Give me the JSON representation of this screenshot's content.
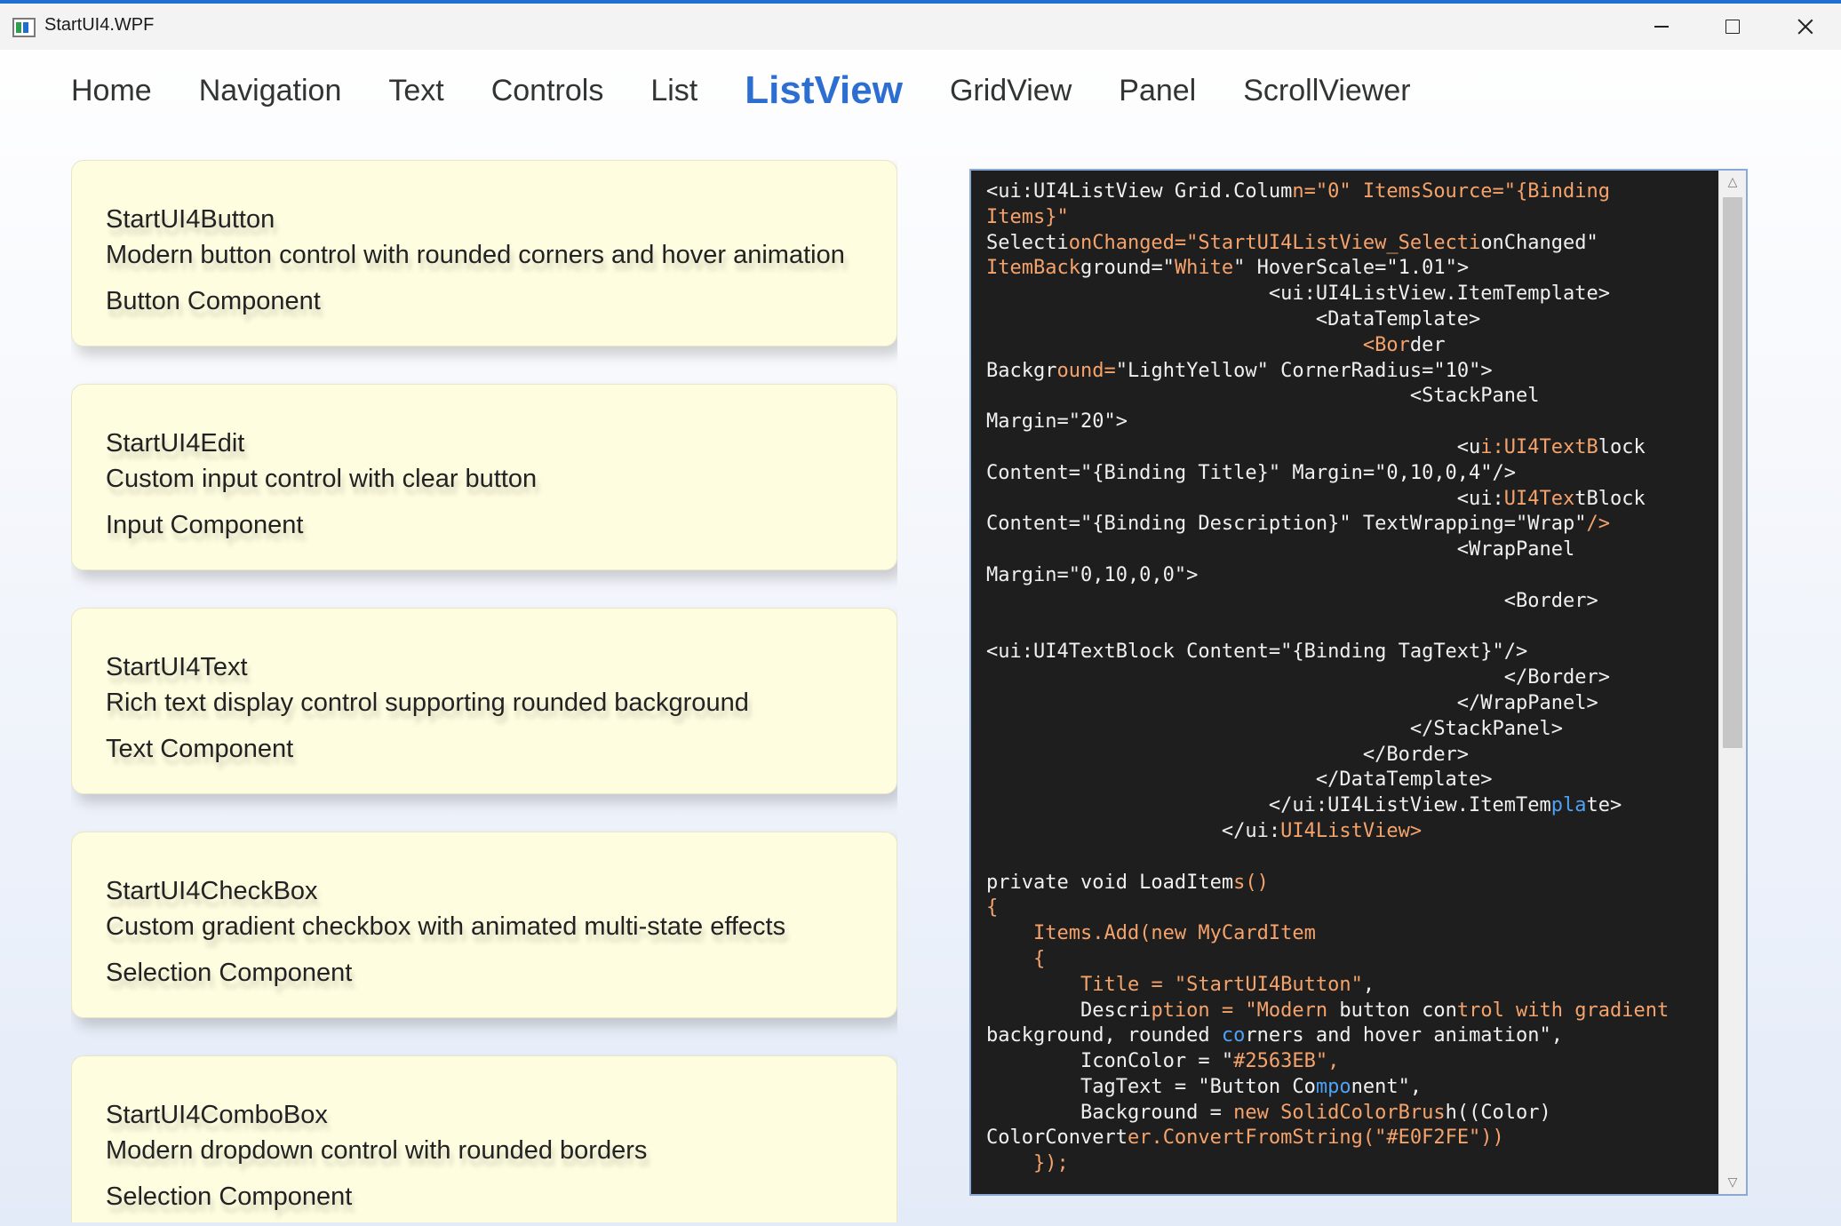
{
  "window": {
    "title": "StartUI4.WPF",
    "accent": "#1f6fd0"
  },
  "nav": {
    "items": [
      {
        "label": "Home"
      },
      {
        "label": "Navigation"
      },
      {
        "label": "Text"
      },
      {
        "label": "Controls"
      },
      {
        "label": "List"
      },
      {
        "label": "ListView",
        "active": true
      },
      {
        "label": "GridView"
      },
      {
        "label": "Panel"
      },
      {
        "label": "ScrollViewer"
      }
    ],
    "active_color": "#2d6fd1"
  },
  "cards": [
    {
      "title": "StartUI4Button",
      "description": "Modern button control with rounded corners and hover animation",
      "tag": "Button Component"
    },
    {
      "title": "StartUI4Edit",
      "description": "Custom input control with clear button",
      "tag": "Input Component"
    },
    {
      "title": "StartUI4Text",
      "description": "Rich text display control supporting rounded background",
      "tag": "Text Component"
    },
    {
      "title": "StartUI4CheckBox",
      "description": "Custom gradient checkbox with animated multi-state effects",
      "tag": "Selection Component"
    },
    {
      "title": "StartUI4ComboBox",
      "description": "Modern dropdown control with rounded borders",
      "tag": "Selection Component"
    }
  ],
  "card_background": "#fffde0",
  "code_colors": {
    "default": "#f0f0f0",
    "orange": "#f5a36b",
    "blue": "#4ea1f3"
  },
  "code": [
    [
      {
        "t": "<ui:UI4ListView Grid.Colum"
      },
      {
        "t": "n=\"0\" ItemsSource=\"{Binding",
        "c": "orange"
      }
    ],
    [
      {
        "t": "Items}\"",
        "c": "orange"
      }
    ],
    [
      {
        "t": "Selecti"
      },
      {
        "t": "onChanged=\"StartUI4ListView_Selecti",
        "c": "orange"
      },
      {
        "t": "onChanged\""
      }
    ],
    [
      {
        "t": "ItemBack",
        "c": "orange"
      },
      {
        "t": "ground=\""
      },
      {
        "t": "White",
        "c": "orange"
      },
      {
        "t": "\" HoverScale=\"1.01\">"
      }
    ],
    [
      {
        "t": "                        <ui:UI4ListView.ItemTemplate>"
      }
    ],
    [
      {
        "t": "                            <DataTemplate>"
      }
    ],
    [
      {
        "t": "                                <Bor",
        "c": "orange"
      },
      {
        "t": "der"
      }
    ],
    [
      {
        "t": "Backgr"
      },
      {
        "t": "ound=",
        "c": "orange"
      },
      {
        "t": "\"LightYellow\" CornerRadius=\"10\">"
      }
    ],
    [
      {
        "t": "                                    <StackPanel"
      }
    ],
    [
      {
        "t": "Margin=\"20\">"
      }
    ],
    [
      {
        "t": "                                        <u"
      },
      {
        "t": "i:UI4TextB",
        "c": "orange"
      },
      {
        "t": "lock"
      }
    ],
    [
      {
        "t": "Content=\"{Binding Title}\" Margin=\"0,10,0,4\"/>"
      }
    ],
    [
      {
        "t": "                                        <ui:"
      },
      {
        "t": "UI4Tex",
        "c": "orange"
      },
      {
        "t": "tBlock"
      }
    ],
    [
      {
        "t": "Content=\"{Binding Description}\" TextWrapping=\"Wrap\""
      },
      {
        "t": "/>",
        "c": "orange"
      }
    ],
    [
      {
        "t": "                                        <WrapPanel"
      }
    ],
    [
      {
        "t": "Margin=\"0,10,0,0\">"
      }
    ],
    [
      {
        "t": "                                            <Border>"
      }
    ],
    [
      {
        "t": ""
      }
    ],
    [
      {
        "t": "<ui:UI4TextBlock Content=\"{Binding TagText}\"/>"
      }
    ],
    [
      {
        "t": "                                            </Border>"
      }
    ],
    [
      {
        "t": "                                        </WrapPanel>"
      }
    ],
    [
      {
        "t": "                                    </StackPanel>"
      }
    ],
    [
      {
        "t": "                                </Border>"
      }
    ],
    [
      {
        "t": "                            </DataTemplate>"
      }
    ],
    [
      {
        "t": "                        </ui:UI4ListView.ItemTem"
      },
      {
        "t": "pla",
        "c": "blue"
      },
      {
        "t": "te>"
      }
    ],
    [
      {
        "t": "                    </ui:"
      },
      {
        "t": "UI4ListView>",
        "c": "orange"
      }
    ],
    [
      {
        "t": ""
      }
    ],
    [
      {
        "t": "private void LoadItem"
      },
      {
        "t": "s()",
        "c": "orange"
      }
    ],
    [
      {
        "t": "{",
        "c": "orange"
      }
    ],
    [
      {
        "t": "    "
      },
      {
        "t": "Items.Add(new MyCardItem",
        "c": "orange"
      }
    ],
    [
      {
        "t": "    "
      },
      {
        "t": "{",
        "c": "orange"
      }
    ],
    [
      {
        "t": "        "
      },
      {
        "t": "Title = \"StartUI4Button\"",
        "c": "orange"
      },
      {
        "t": ","
      }
    ],
    [
      {
        "t": "        Descri"
      },
      {
        "t": "ption = \"Modern",
        "c": "orange"
      },
      {
        "t": " button con"
      },
      {
        "t": "trol with gradient",
        "c": "orange"
      }
    ],
    [
      {
        "t": "background, rounded "
      },
      {
        "t": "co",
        "c": "blue"
      },
      {
        "t": "rners and hover animation\","
      }
    ],
    [
      {
        "t": "        IconColor = \""
      },
      {
        "t": "#2563EB\",",
        "c": "orange"
      }
    ],
    [
      {
        "t": "        TagText = \"Button Co"
      },
      {
        "t": "mpo",
        "c": "blue"
      },
      {
        "t": "nent\","
      }
    ],
    [
      {
        "t": "        Background = "
      },
      {
        "t": "new SolidColorBrus",
        "c": "orange"
      },
      {
        "t": "h((Color)"
      }
    ],
    [
      {
        "t": "ColorConvert"
      },
      {
        "t": "er.ConvertFromString(\"#E0F2FE\"))",
        "c": "orange"
      }
    ],
    [
      {
        "t": "    "
      },
      {
        "t": "});",
        "c": "orange"
      }
    ]
  ],
  "scrollbar": {
    "position": 0.0
  }
}
